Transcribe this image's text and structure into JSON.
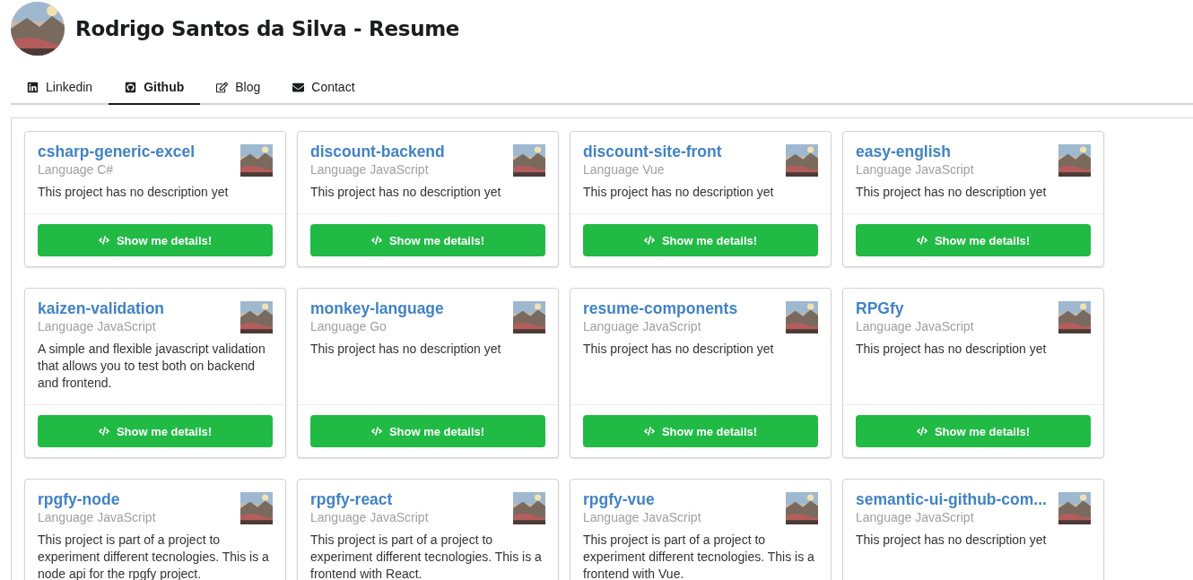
{
  "header": {
    "title": "Rodrigo Santos da Silva - Resume"
  },
  "tabs": [
    {
      "label": "Linkedin",
      "kind": "linkedin",
      "selected": false
    },
    {
      "label": "Github",
      "kind": "github",
      "selected": true
    },
    {
      "label": "Blog",
      "kind": "edit",
      "selected": false
    },
    {
      "label": "Contact",
      "kind": "envelope",
      "selected": false
    }
  ],
  "projects": [
    {
      "name": "csharp-generic-excel",
      "language": "Language C#",
      "description": "This project has no description yet",
      "button": "Show me details!"
    },
    {
      "name": "discount-backend",
      "language": "Language JavaScript",
      "description": "This project has no description yet",
      "button": "Show me details!"
    },
    {
      "name": "discount-site-front",
      "language": "Language Vue",
      "description": "This project has no description yet",
      "button": "Show me details!"
    },
    {
      "name": "easy-english",
      "language": "Language JavaScript",
      "description": "This project has no description yet",
      "button": "Show me details!"
    },
    {
      "name": "kaizen-validation",
      "language": "Language JavaScript",
      "description": "A simple and flexible javascript validation that allows you to test both on backend and frontend.",
      "button": "Show me details!"
    },
    {
      "name": "monkey-language",
      "language": "Language Go",
      "description": "This project has no description yet",
      "button": "Show me details!"
    },
    {
      "name": "resume-components",
      "language": "Language JavaScript",
      "description": "This project has no description yet",
      "button": "Show me details!"
    },
    {
      "name": "RPGfy",
      "language": "Language JavaScript",
      "description": "This project has no description yet",
      "button": "Show me details!"
    },
    {
      "name": "rpgfy-node",
      "language": "Language JavaScript",
      "description": "This project is part of a project to experiment different tecnologies. This is a node api for the rpgfy project."
    },
    {
      "name": "rpgfy-react",
      "language": "Language JavaScript",
      "description": "This project is part of a project to experiment different tecnologies. This is a frontend with React."
    },
    {
      "name": "rpgfy-vue",
      "language": "Language JavaScript",
      "description": "This project is part of a project to experiment different tecnologies. This is a frontend with Vue."
    },
    {
      "name": "semantic-ui-github-com...",
      "language": "Language JavaScript",
      "description": "This project has no description yet"
    }
  ]
}
